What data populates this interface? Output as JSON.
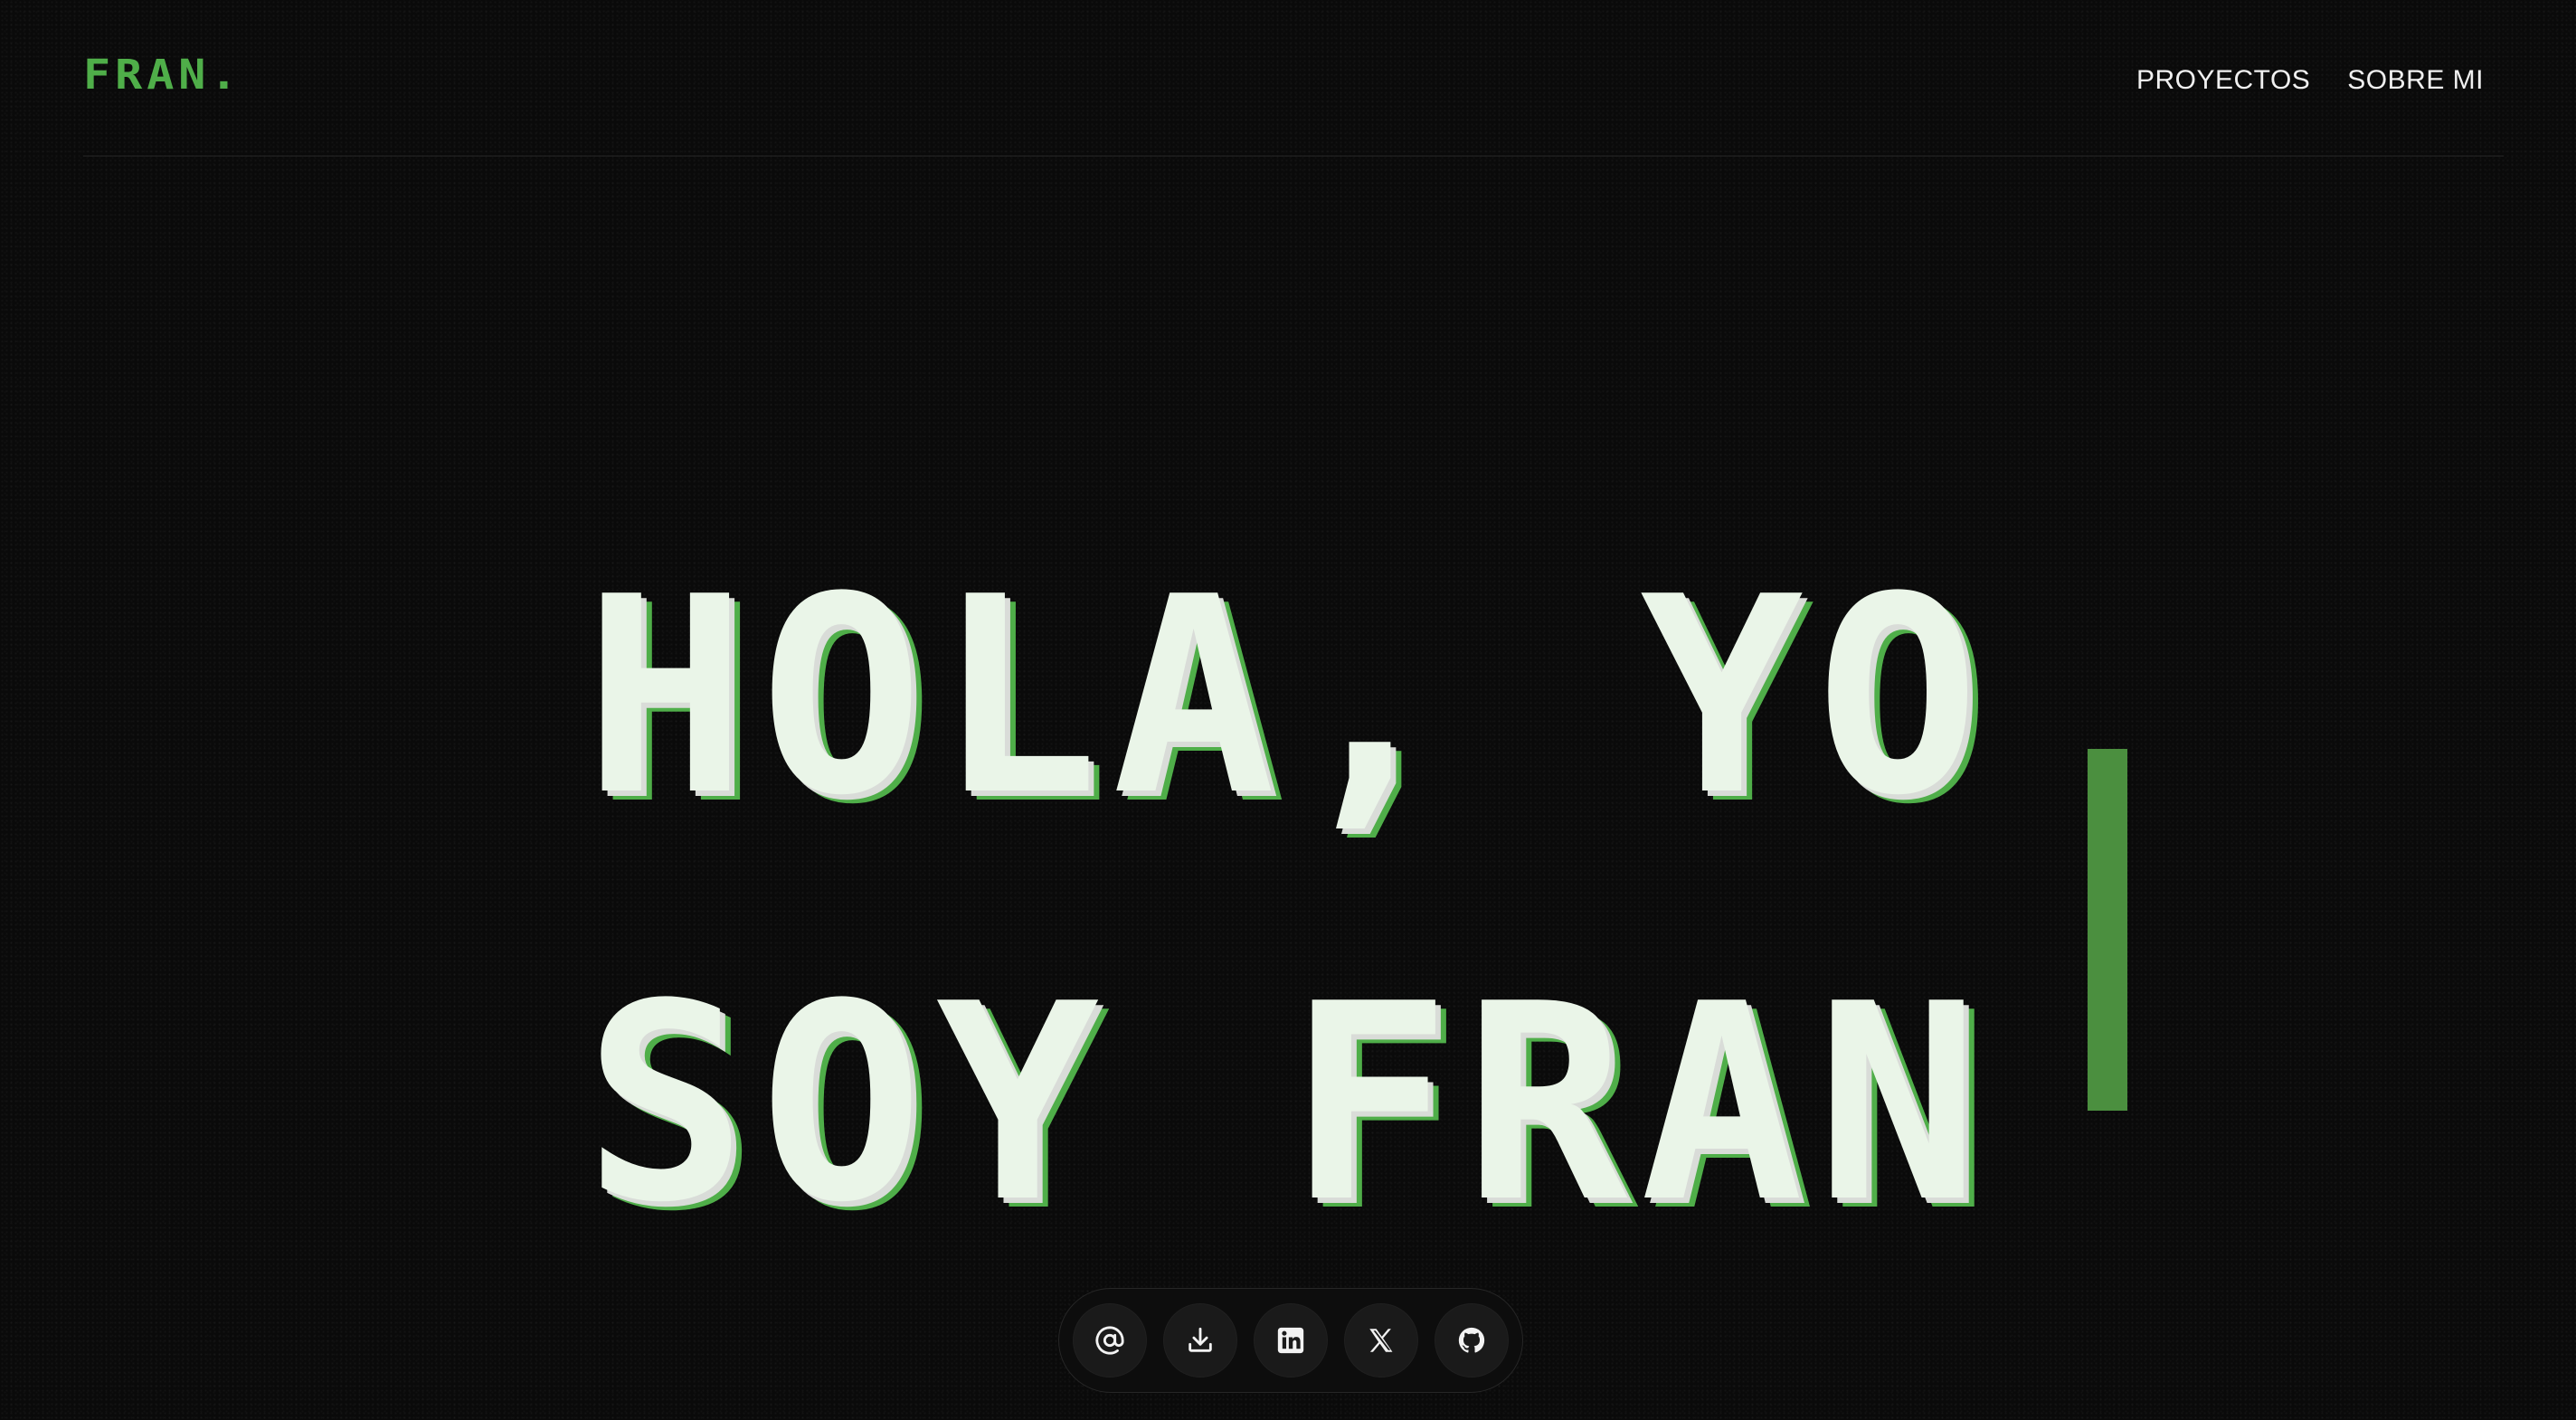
{
  "header": {
    "logo": "FRAN.",
    "nav": [
      {
        "label": "PROYECTOS"
      },
      {
        "label": "SOBRE MI"
      }
    ]
  },
  "hero": {
    "line1": "HOLA, YO",
    "line2": "SOY FRAN"
  },
  "social": [
    {
      "icon": "at-sign-icon",
      "name": "email"
    },
    {
      "icon": "download-icon",
      "name": "download-cv"
    },
    {
      "icon": "linkedin-icon",
      "name": "linkedin"
    },
    {
      "icon": "x-icon",
      "name": "x"
    },
    {
      "icon": "github-icon",
      "name": "github"
    }
  ],
  "colors": {
    "accent": "#4fae49",
    "cursor": "#4b8f3f",
    "background": "#0a0a0a",
    "text": "#eaf5e8"
  }
}
